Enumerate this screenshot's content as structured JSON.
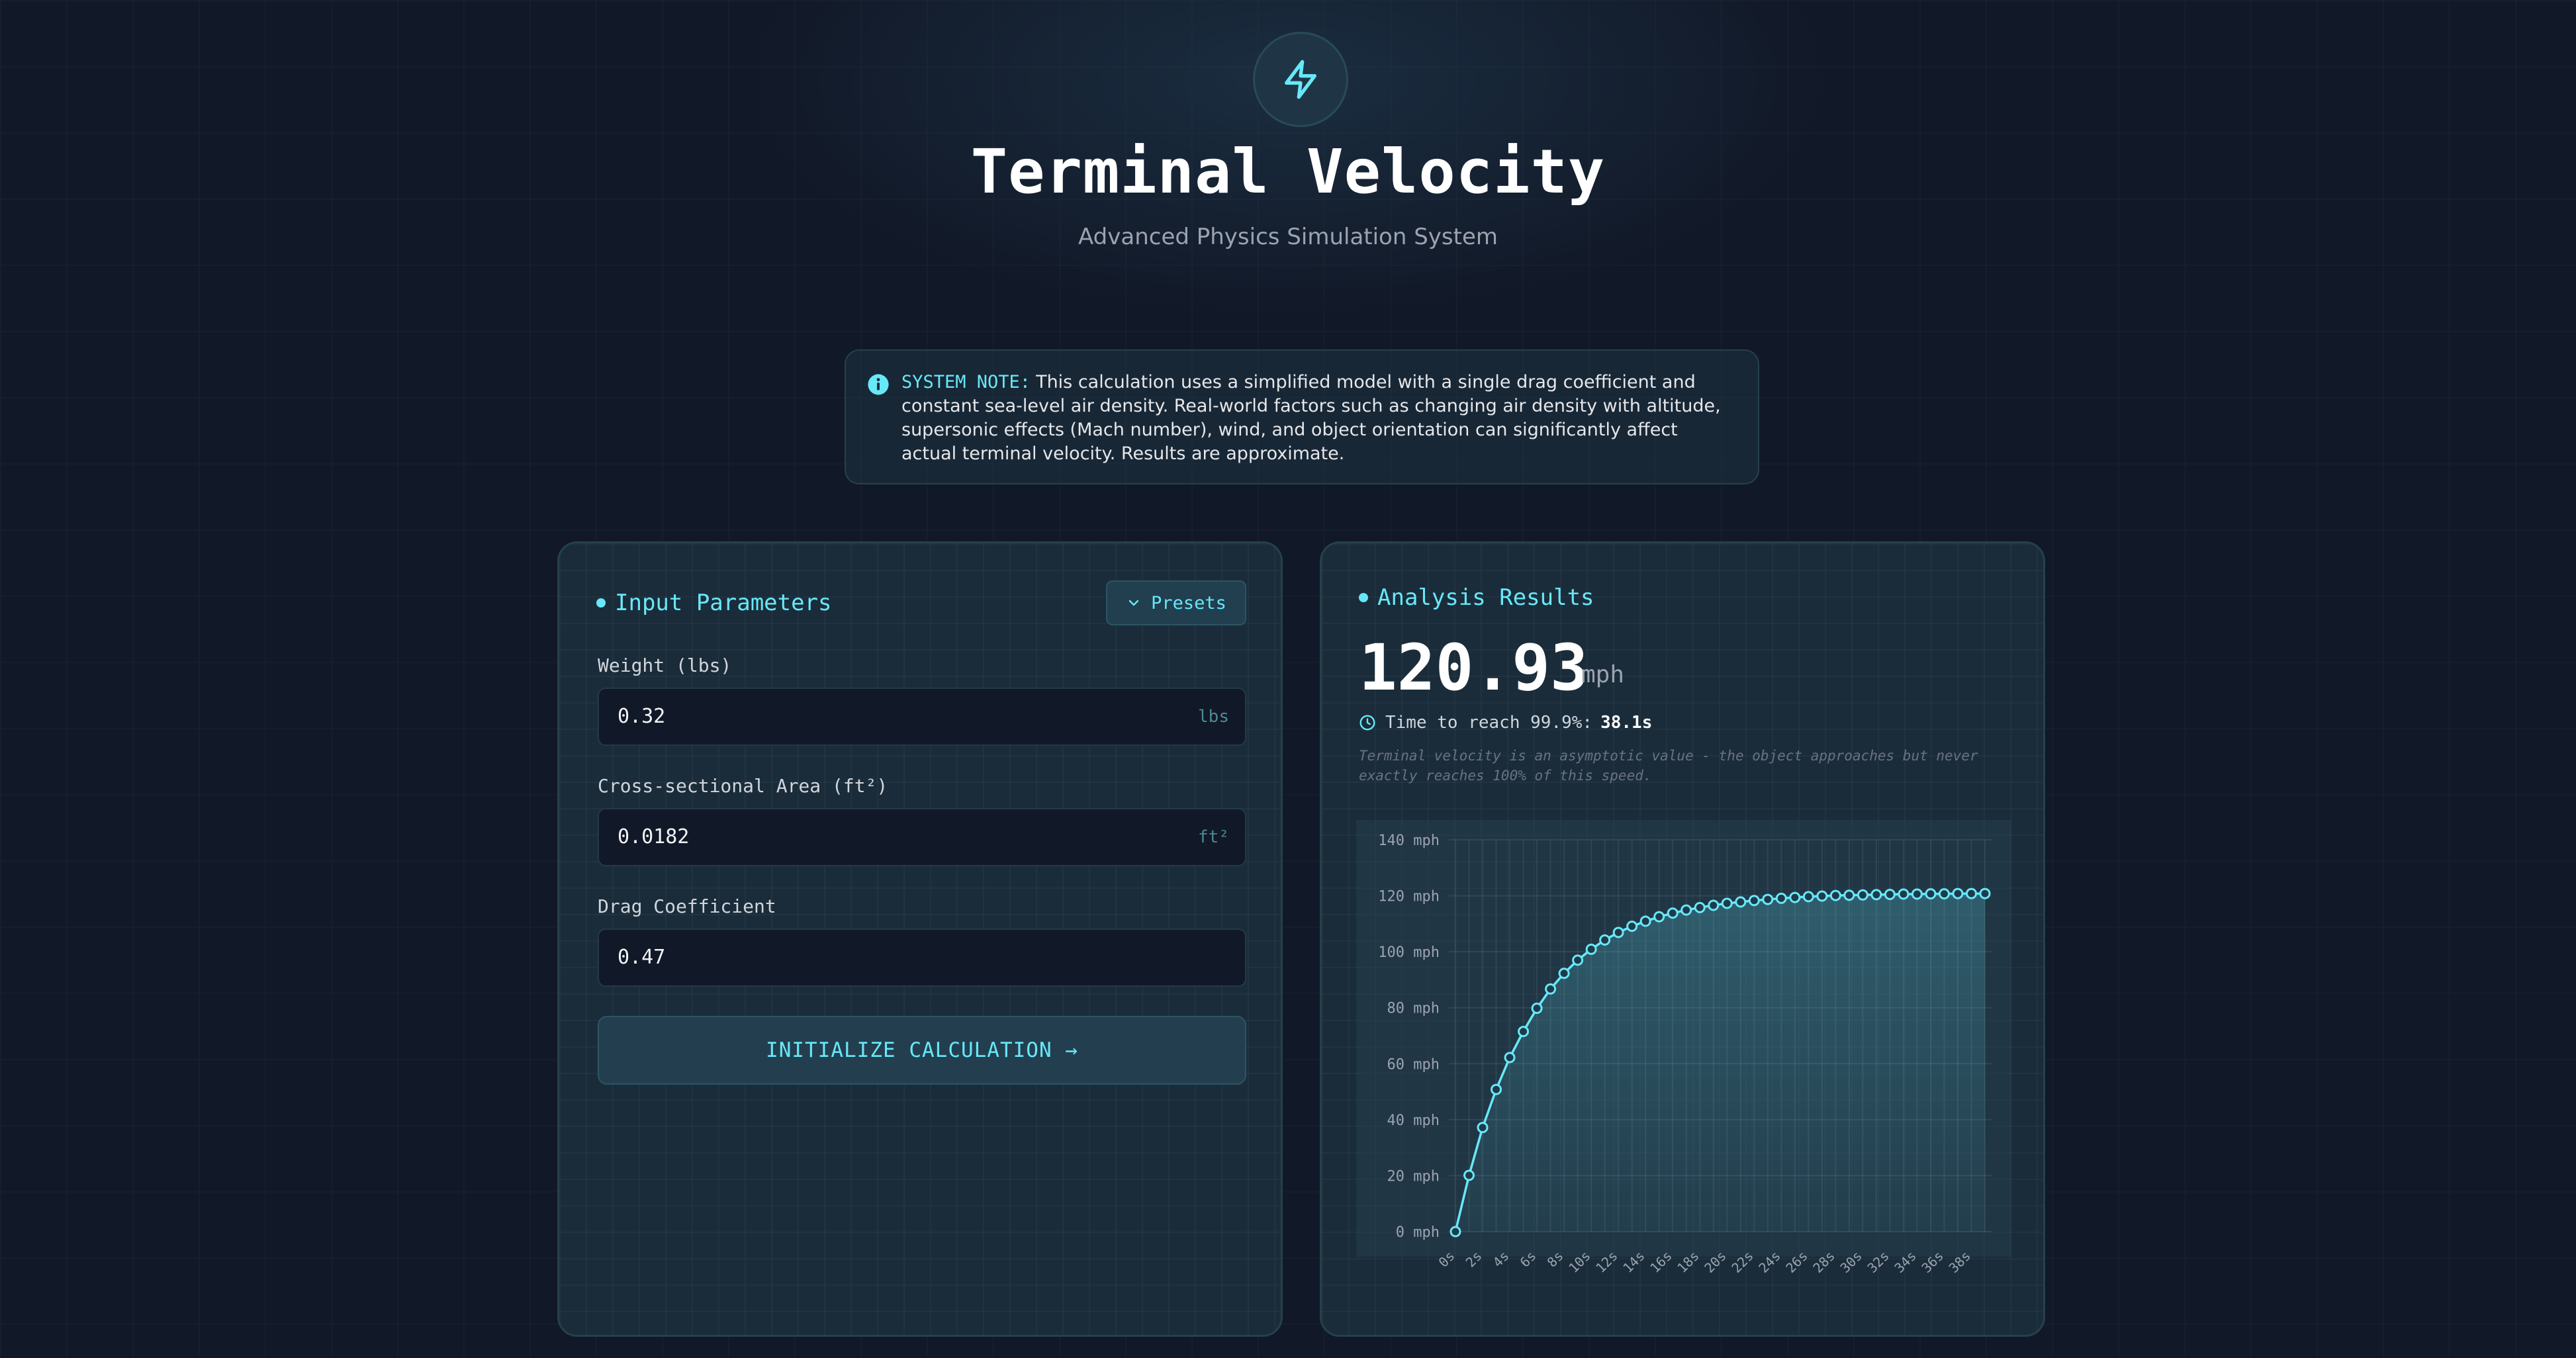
{
  "header": {
    "icon": "lightning-bolt-icon",
    "title": "Terminal Velocity",
    "subtitle": "Advanced Physics Simulation System"
  },
  "note": {
    "icon": "info-icon",
    "label": "SYSTEM NOTE:",
    "text": "This calculation uses a simplified model with a single drag coefficient and constant sea-level air density. Real-world factors such as changing air density with altitude, supersonic effects (Mach number), wind, and object orientation can significantly affect actual terminal velocity. Results are approximate."
  },
  "inputs": {
    "heading": "Input Parameters",
    "presets_label": "Presets",
    "weight": {
      "label": "Weight (lbs)",
      "value": "0.32",
      "unit": "lbs"
    },
    "area": {
      "label": "Cross-sectional Area (ft²)",
      "value": "0.0182",
      "unit": "ft²"
    },
    "drag": {
      "label": "Drag Coefficient",
      "value": "0.47"
    },
    "calculate_label": "INITIALIZE CALCULATION →"
  },
  "results": {
    "heading": "Analysis Results",
    "velocity": "120.93",
    "velocity_unit": "mph",
    "time_label": "Time to reach 99.9%:",
    "time_value": "38.1s",
    "note": "Terminal velocity is an asymptotic value - the object approaches but never exactly reaches 100% of this speed."
  },
  "colors": {
    "accent": "#67e8f9",
    "background": "#111827",
    "panel": "#1a2c3a"
  },
  "chart_data": {
    "type": "area",
    "title": "",
    "xlabel": "",
    "ylabel": "",
    "ylim": [
      0,
      140
    ],
    "y_ticks": [
      "0 mph",
      "20 mph",
      "40 mph",
      "60 mph",
      "80 mph",
      "100 mph",
      "120 mph",
      "140 mph"
    ],
    "x_tick_labels": [
      "0s",
      "2s",
      "4s",
      "6s",
      "8s",
      "10s",
      "12s",
      "14s",
      "16s",
      "18s",
      "20s",
      "22s",
      "24s",
      "26s",
      "28s",
      "30s",
      "32s",
      "34s",
      "36s",
      "38s"
    ],
    "x": [
      0,
      1,
      2,
      3,
      4,
      5,
      6,
      7,
      8,
      9,
      10,
      11,
      12,
      13,
      14,
      15,
      16,
      17,
      18,
      19,
      20,
      21,
      22,
      23,
      24,
      25,
      26,
      27,
      28,
      29,
      30,
      31,
      32,
      33,
      34,
      35,
      36,
      37,
      38,
      39
    ],
    "series": [
      {
        "values": [
          0,
          20.1,
          37.2,
          50.8,
          62.2,
          71.5,
          79.8,
          86.7,
          92.3,
          97.0,
          100.9,
          104.2,
          106.9,
          109.1,
          110.9,
          112.5,
          113.8,
          114.9,
          115.8,
          116.6,
          117.3,
          117.8,
          118.3,
          118.7,
          119.1,
          119.4,
          119.7,
          119.9,
          120.1,
          120.2,
          120.3,
          120.4,
          120.5,
          120.6,
          120.6,
          120.7,
          120.7,
          120.8,
          120.8,
          120.8
        ]
      }
    ],
    "grid": true,
    "legend": "none"
  }
}
